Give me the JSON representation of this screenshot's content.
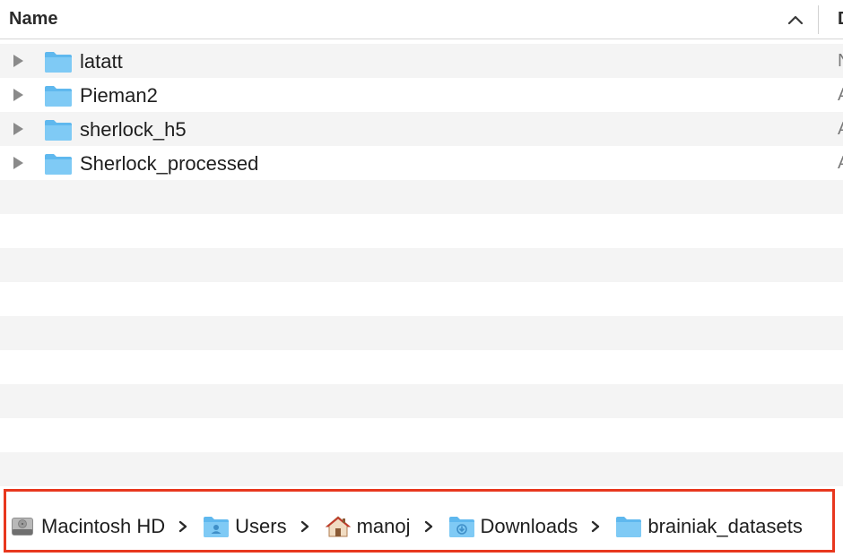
{
  "header": {
    "name_label": "Name",
    "next_column_label": "D"
  },
  "rows": [
    {
      "name": "latatt",
      "kind_truncated": "N"
    },
    {
      "name": "Pieman2",
      "kind_truncated": "A"
    },
    {
      "name": "sherlock_h5",
      "kind_truncated": "A"
    },
    {
      "name": "Sherlock_processed",
      "kind_truncated": "A"
    }
  ],
  "pathbar": {
    "crumbs": [
      {
        "label": "Macintosh HD",
        "icon": "hard-drive-icon"
      },
      {
        "label": "Users",
        "icon": "users-folder-icon"
      },
      {
        "label": "manoj",
        "icon": "home-icon"
      },
      {
        "label": "Downloads",
        "icon": "downloads-folder-icon"
      },
      {
        "label": "brainiak_datasets",
        "icon": "folder-icon"
      }
    ]
  },
  "colors": {
    "folder": "#6cc3f2",
    "highlight_border": "#e8371e",
    "stripe": "#f4f4f4"
  }
}
